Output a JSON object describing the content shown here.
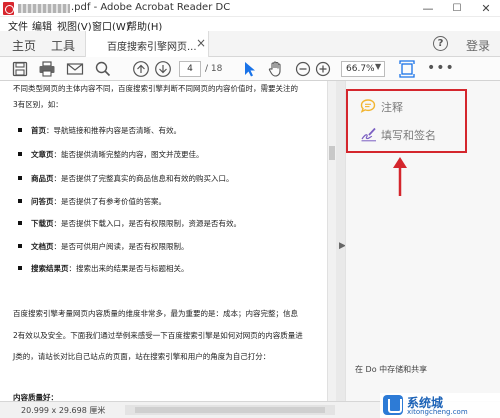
{
  "window": {
    "title_text": ".pdf - Adobe Acrobat Reader DC",
    "minimize": "—",
    "maximize": "☐",
    "close": "✕"
  },
  "menu": [
    "文件",
    "编辑",
    "视图(V)",
    "窗口(W)",
    "帮助(H)"
  ],
  "tabs": {
    "home": "主页",
    "tools": "工具",
    "document": "百度搜索引擎网页...",
    "close": "×",
    "help": "?",
    "signin": "登录"
  },
  "toolbar": {
    "icons": [
      "save-icon",
      "print-icon",
      "email-icon",
      "search-icon",
      "page-up-icon",
      "page-down-icon",
      "select-cursor-icon",
      "hand-icon",
      "zoom-out-icon",
      "zoom-in-icon",
      "fit-page-icon",
      "more-icon"
    ],
    "page_current": "4",
    "page_total": "/ 18",
    "zoom": "66.7%",
    "zoom_caret": "▼",
    "more": "•••"
  },
  "document": {
    "top_line": "不同类型网页的主体内容不同，百度搜索引擎判断不同网页的内容价值时，需要关注的",
    "top_line2": "3有区别，如：",
    "bullets": [
      {
        "term": "首页",
        "text": "：导航链接和推荐内容是否清晰、有效。"
      },
      {
        "term": "文章页",
        "text": "：能否提供清晰完整的内容，图文并茂更佳。"
      },
      {
        "term": "商品页",
        "text": "：是否提供了完整真实的商品信息和有效的购买入口。"
      },
      {
        "term": "问答页",
        "text": "：是否提供了有参考价值的答案。"
      },
      {
        "term": "下载页",
        "text": "：是否提供下载入口，是否有权限限制，资源是否有效。"
      },
      {
        "term": "文档页",
        "text": "：是否可供用户阅读，是否有权限限制。"
      },
      {
        "term": "搜索结果页",
        "text": "：搜索出来的结果是否与标题相关。"
      }
    ],
    "para1": "百度搜索引擎考量网页内容质量的维度非常多，最为重要的是：成本；内容完整；信息",
    "para2": "2有效以及安全。下面我们通过举例来感受一下百度搜索引擎是如何对网页的内容质量进",
    "para3": "J类的，请站长对比自己站点的页面，站在搜索引擎和用户的角度为自己打分：",
    "heading": "内容质量好："
  },
  "panel": {
    "comment_label": "注释",
    "sign_label": "填写和签名",
    "bottom_text": "在 Do",
    "bottom_text2": "中存储和共享"
  },
  "status": {
    "page_size": "20.999 x 29.698 厘米"
  },
  "watermark": {
    "title": "系统城",
    "url": "xitongcheng.com"
  },
  "colors": {
    "highlight": "#d4262d",
    "comment_icon": "#f2b531",
    "sign_icon": "#7b5fc2",
    "accent_blue": "#1a73e8"
  }
}
